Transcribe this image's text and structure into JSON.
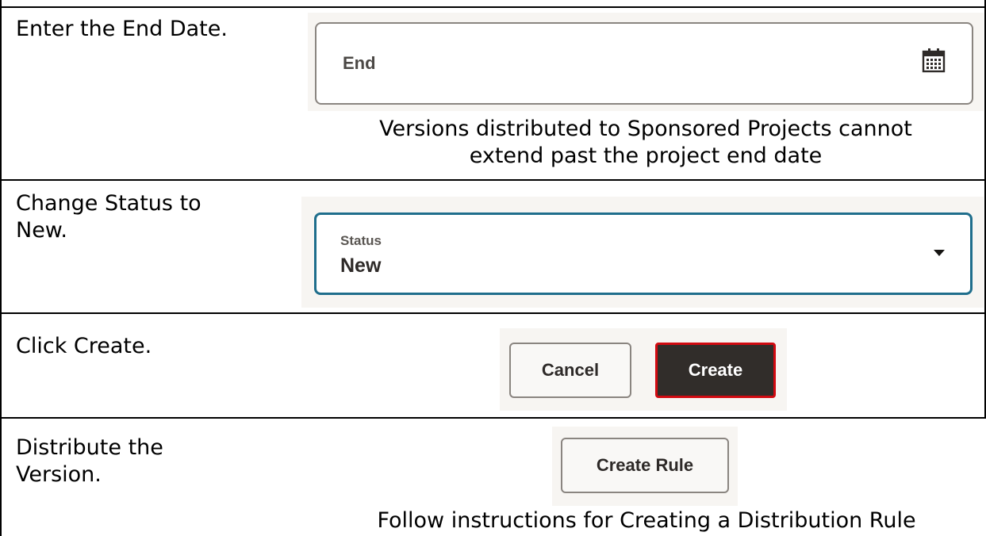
{
  "rows": [
    {
      "instruction": "Enter the End Date.",
      "field_label": "End",
      "field_icon": "calendar-icon",
      "caption_line1": "Versions distributed to Sponsored Projects cannot",
      "caption_line2": "extend past the project end date"
    },
    {
      "instruction_line1": "Change Status to",
      "instruction_line2": "New.",
      "field_label": "Status",
      "field_value": "New",
      "field_icon": "caret-down-icon"
    },
    {
      "instruction": "Click Create.",
      "cancel_label": "Cancel",
      "create_label": "Create"
    },
    {
      "instruction_line1": "Distribute the",
      "instruction_line2": "Version.",
      "button_label": "Create Rule",
      "caption": "Follow instructions for Creating a Distribution Rule"
    }
  ],
  "colors": {
    "field_border": "#8a8580",
    "field_focus_border": "#1f6e8c",
    "highlight": "#d10a11",
    "primary_button": "#312d2a"
  }
}
